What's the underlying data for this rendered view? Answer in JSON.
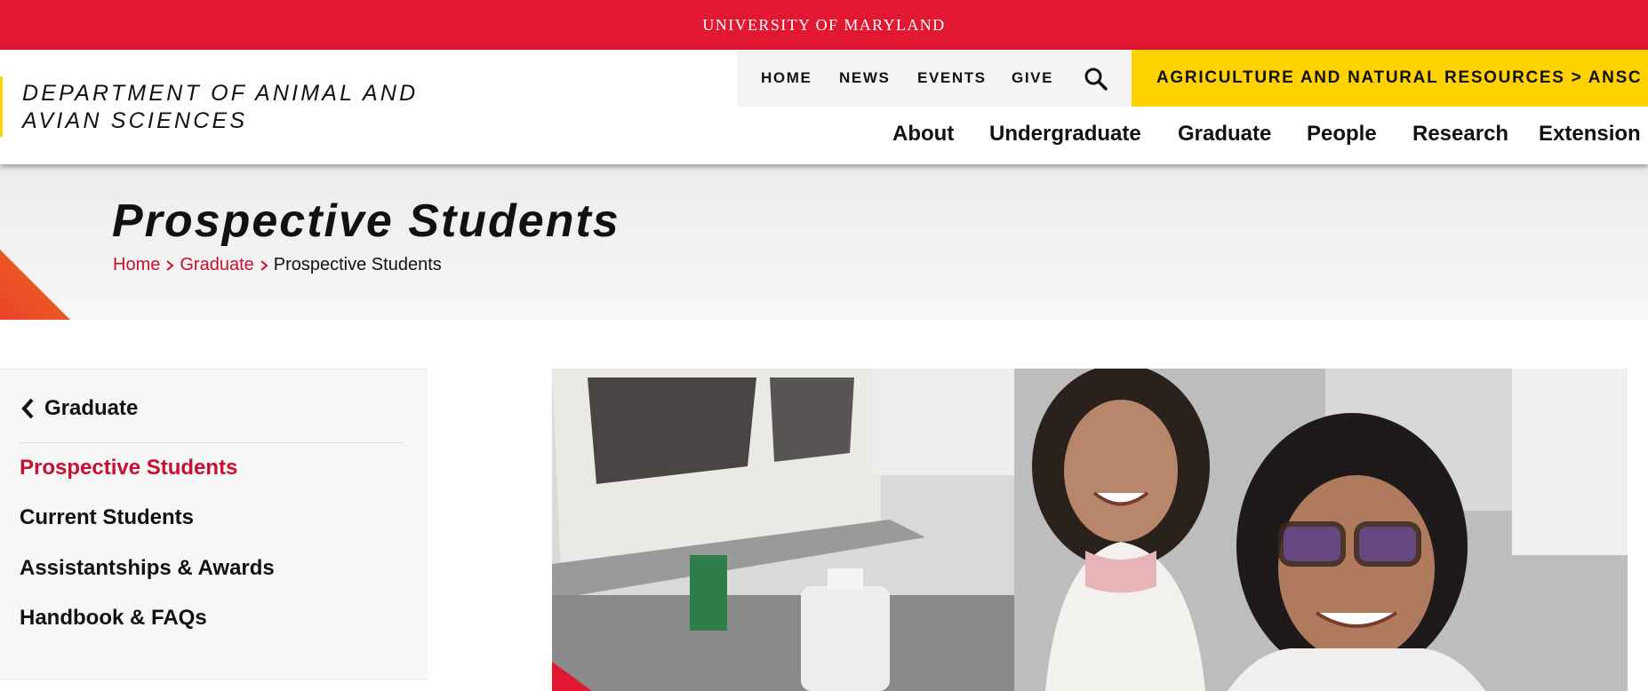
{
  "umd_bar": {
    "label": "UNIVERSITY OF MARYLAND"
  },
  "header": {
    "dept_name_line1": "DEPARTMENT OF ANIMAL AND",
    "dept_name_line2": "AVIAN SCIENCES",
    "utility_nav": [
      "HOME",
      "NEWS",
      "EVENTS",
      "GIVE"
    ],
    "search_icon": "search-icon",
    "college_link": "AGRICULTURE AND NATURAL RESOURCES > ANSC",
    "main_nav": [
      "About",
      "Undergraduate",
      "Graduate",
      "People",
      "Research",
      "Extension"
    ]
  },
  "hero": {
    "title": "Prospective Students",
    "breadcrumb": [
      "Home",
      "Graduate",
      "Prospective Students"
    ]
  },
  "sidebar": {
    "back_label": "Graduate",
    "items": [
      {
        "label": "Prospective Students",
        "active": true
      },
      {
        "label": "Current Students",
        "active": false
      },
      {
        "label": "Assistantships & Awards",
        "active": false
      },
      {
        "label": "Handbook & FAQs",
        "active": false
      }
    ]
  },
  "colors": {
    "umd_red": "#e21833",
    "link_red": "#c8102e",
    "gold": "#ffd200"
  }
}
